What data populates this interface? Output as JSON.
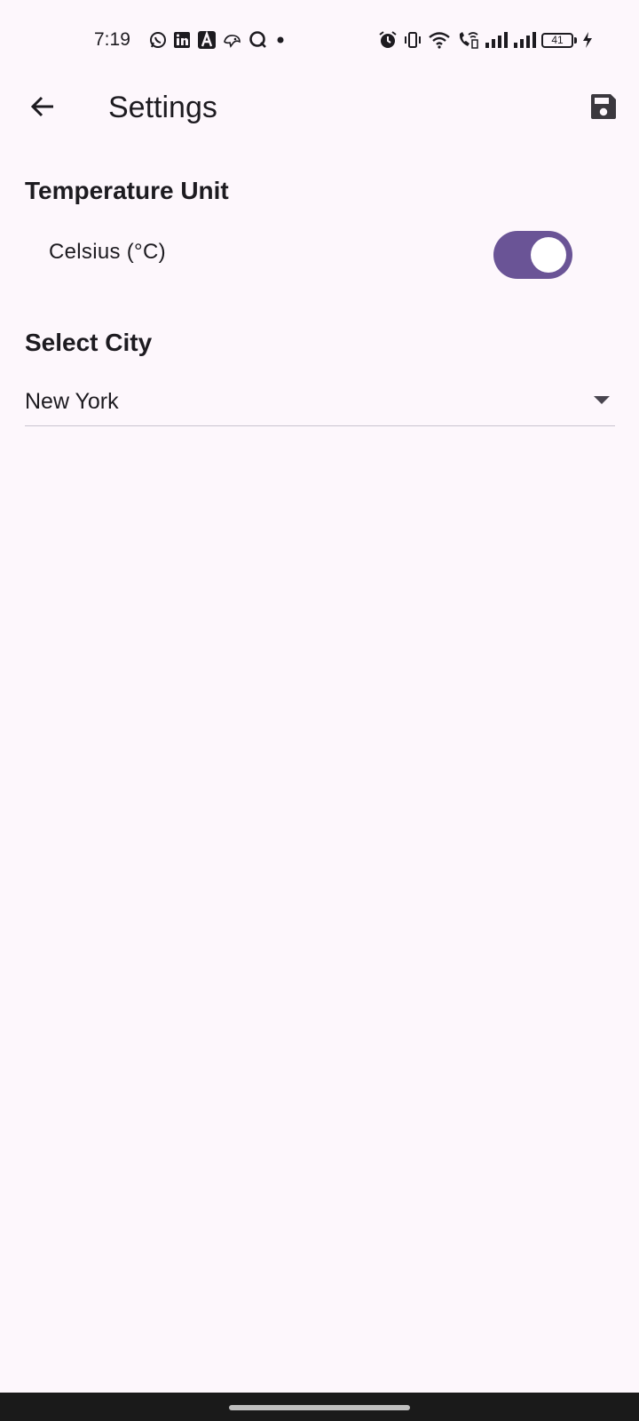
{
  "status_bar": {
    "time": "7:19",
    "battery_level": "41",
    "left_icons": [
      "whatsapp-icon",
      "linkedin-icon",
      "a-app-icon",
      "chameleon-icon",
      "q-app-icon",
      "dot-icon"
    ],
    "right_icons": [
      "alarm-icon",
      "vibrate-icon",
      "wifi-icon",
      "wifi-calling-icon",
      "signal-1-icon",
      "signal-2-icon",
      "battery-icon",
      "charging-icon"
    ]
  },
  "app_bar": {
    "title": "Settings",
    "back_icon": "arrow-back-icon",
    "save_icon": "save-icon"
  },
  "temperature": {
    "heading": "Temperature Unit",
    "option_label": "Celsius (°C)",
    "enabled": true
  },
  "city": {
    "heading": "Select City",
    "selected": "New York"
  },
  "colors": {
    "background": "#fdf7fc",
    "switch_on": "#6a5496",
    "text": "#1d1b20"
  }
}
